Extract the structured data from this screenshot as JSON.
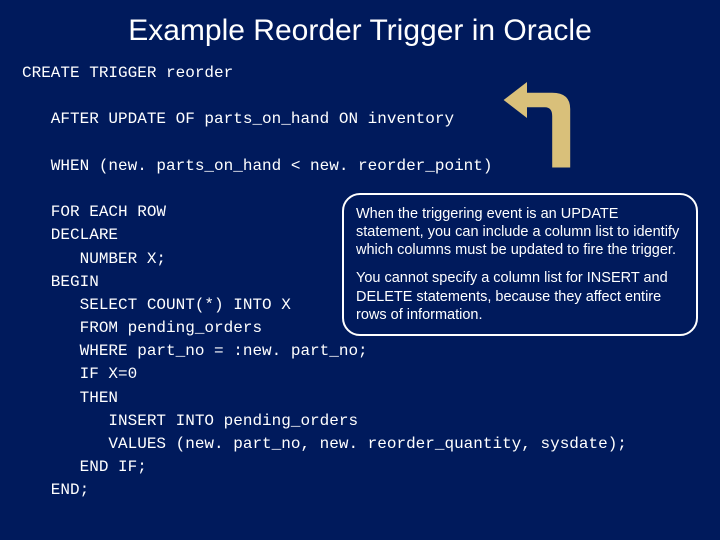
{
  "title": "Example Reorder Trigger in Oracle",
  "code": {
    "l1": "CREATE TRIGGER reorder",
    "l2": "",
    "l3": "   AFTER UPDATE OF parts_on_hand ON inventory",
    "l4": "",
    "l5": "   WHEN (new. parts_on_hand < new. reorder_point)",
    "l6": "",
    "l7": "   FOR EACH ROW",
    "l8": "   DECLARE",
    "l9": "      NUMBER X;",
    "l10": "   BEGIN",
    "l11": "      SELECT COUNT(*) INTO X",
    "l12": "      FROM pending_orders",
    "l13": "      WHERE part_no = :new. part_no;",
    "l14": "      IF X=0",
    "l15": "      THEN",
    "l16": "         INSERT INTO pending_orders",
    "l17": "         VALUES (new. part_no, new. reorder_quantity, sysdate);",
    "l18": "      END IF;",
    "l19": "   END;"
  },
  "callout": {
    "p1": "When the triggering event is an UPDATE statement, you can include a column list to identify which columns must be updated to fire the trigger.",
    "p2": "You cannot specify a column list for INSERT and DELETE statements, because they affect entire rows of information."
  },
  "colors": {
    "bg": "#001a5c",
    "arrow": "#d9c07a"
  }
}
